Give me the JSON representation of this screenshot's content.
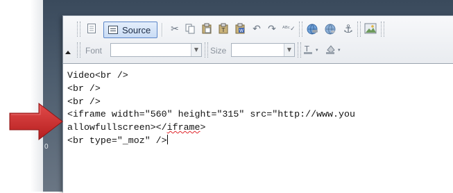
{
  "toolbar": {
    "source_label": "Source",
    "font_label": "Font",
    "font_value": "",
    "size_label": "Size",
    "size_value": "",
    "icons_row1": [
      "page-icon",
      "source-icon",
      "cut-icon",
      "copy-icon",
      "paste-icon",
      "paste-text-icon",
      "paste-word-icon",
      "undo-icon",
      "redo-icon",
      "spellcheck-icon",
      "link-icon",
      "unlink-icon",
      "anchor-icon",
      "image-icon"
    ],
    "icons_row2": [
      "text-color-icon",
      "bg-color-icon"
    ]
  },
  "editor": {
    "lines": [
      "Video<br />",
      "<br />",
      "<br />",
      "<iframe width=\"560\" height=\"315\" src=\"http://www.you",
      "allowfullscreen></iframe>",
      "<br type=\"_moz\" />"
    ],
    "line5_prefix": "allowfullscreen></",
    "line5_flagged": "iframe",
    "line5_suffix": ">"
  },
  "background": {
    "side_number": "0"
  },
  "colors": {
    "arrow": "#d42b2b",
    "source_button_bg": "#cfe0f6",
    "source_button_border": "#5b86c8",
    "spellcheck_underline": "#e0242a"
  }
}
